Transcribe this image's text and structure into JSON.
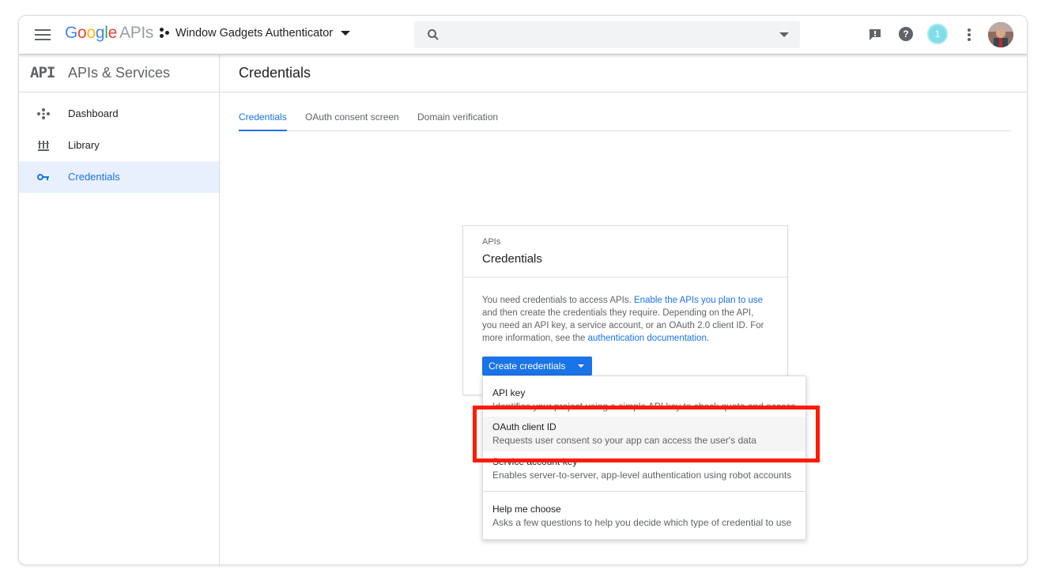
{
  "topbar": {
    "logo_google": [
      "G",
      "o",
      "o",
      "g",
      "l",
      "e"
    ],
    "logo_apis": "APIs",
    "project_name": "Window Gadgets Authenticator",
    "search_placeholder": "",
    "notification_count": "1",
    "feedback_icon": "feedback-icon",
    "help_icon": "help-icon"
  },
  "sidebar": {
    "badge": "API",
    "title": "APIs & Services",
    "items": [
      {
        "label": "Dashboard",
        "icon": "dashboard-icon",
        "active": false
      },
      {
        "label": "Library",
        "icon": "library-icon",
        "active": false
      },
      {
        "label": "Credentials",
        "icon": "key-icon",
        "active": true
      }
    ]
  },
  "main": {
    "title": "Credentials",
    "tabs": [
      {
        "label": "Credentials",
        "active": true
      },
      {
        "label": "OAuth consent screen",
        "active": false
      },
      {
        "label": "Domain verification",
        "active": false
      }
    ]
  },
  "card": {
    "breadcrumb": "APIs",
    "title": "Credentials",
    "desc_part1": "You need credentials to access APIs. ",
    "desc_link1": "Enable the APIs you plan to use",
    "desc_part2": " and then create the credentials they require. Depending on the API, you need an API key, a service account, or an OAuth 2.0 client ID. For more information, see the ",
    "desc_link2": "authentication documentation",
    "desc_part3": ".",
    "create_button": "Create credentials"
  },
  "menu": {
    "items": [
      {
        "title": "API key",
        "desc": "Identifies your project using a simple API key to check quota and access"
      },
      {
        "title": "OAuth client ID",
        "desc": "Requests user consent so your app can access the user's data"
      },
      {
        "title": "Service account key",
        "desc": "Enables server-to-server, app-level authentication using robot accounts"
      },
      {
        "title": "Help me choose",
        "desc": "Asks a few questions to help you decide which type of credential to use"
      }
    ]
  },
  "colors": {
    "accent": "#1a73e8",
    "highlight_box": "#ff1a00",
    "active_bg": "#e8f0fe"
  }
}
